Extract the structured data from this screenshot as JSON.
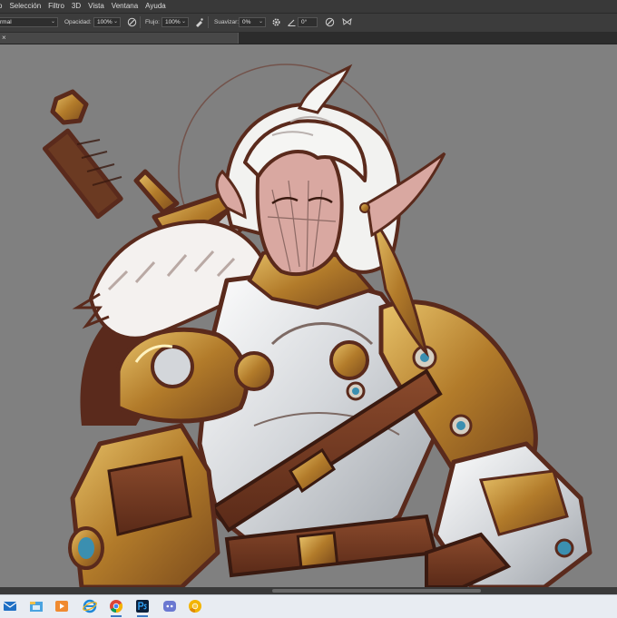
{
  "menu": [
    "o",
    "Selección",
    "Filtro",
    "3D",
    "Vista",
    "Ventana",
    "Ayuda"
  ],
  "options": {
    "mode_value": "rmal",
    "opacity_label": "Opacidad:",
    "opacity_value": "100%",
    "flow_label": "Flujo:",
    "flow_value": "100%",
    "smooth_label": "Suavizar:",
    "smooth_value": "0%",
    "angle_value": "0°"
  },
  "tab": {
    "close": "×"
  },
  "taskbar": {
    "apps": [
      "mail",
      "explorer",
      "media-player",
      "internet-explorer",
      "chrome",
      "photoshop",
      "discord",
      "chrome-canary"
    ]
  },
  "colors": {
    "canvas": "#808080",
    "ui_dark": "#3c3c3c",
    "taskbar": "#e8ecf2",
    "gold": "#c89b3c",
    "outline": "#5a2a1c",
    "armor": "#d9dbde"
  }
}
